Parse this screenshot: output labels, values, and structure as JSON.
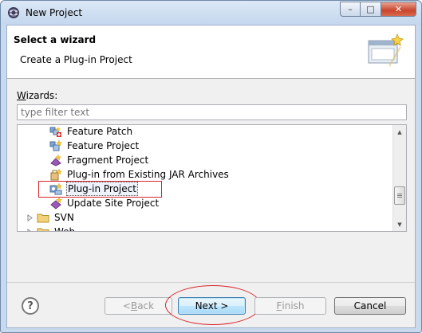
{
  "window": {
    "title": "New Project",
    "controls": {
      "minimize": "–",
      "maximize": "□",
      "close": "✕"
    }
  },
  "header": {
    "title": "Select a wizard",
    "description": "Create a Plug-in Project"
  },
  "wizards": {
    "label_mnemonic": "W",
    "label_rest": "izards:",
    "filter_placeholder": "type filter text"
  },
  "tree": {
    "items": [
      {
        "label": "Feature Patch",
        "icon": "feature-patch-icon"
      },
      {
        "label": "Feature Project",
        "icon": "feature-project-icon"
      },
      {
        "label": "Fragment Project",
        "icon": "fragment-project-icon"
      },
      {
        "label": "Plug-in from Existing JAR Archives",
        "icon": "plugin-jar-icon"
      },
      {
        "label": "Plug-in Project",
        "icon": "plugin-project-icon",
        "selected": true
      },
      {
        "label": "Update Site Project",
        "icon": "update-site-icon"
      },
      {
        "label": "SVN",
        "icon": "folder-icon",
        "collapsed": true
      },
      {
        "label": "Web",
        "icon": "folder-icon",
        "collapsed": true
      }
    ]
  },
  "buttons": {
    "help": "?",
    "back_mnemonic": "B",
    "back_prefix": "< ",
    "back_rest": "ack",
    "next": "Next >",
    "finish_mnemonic": "F",
    "finish_rest": "inish",
    "cancel": "Cancel"
  },
  "colors": {
    "annotation_red": "#d8242a",
    "title_bar": "#c4d7ee",
    "default_button": "#3c7fb1"
  }
}
